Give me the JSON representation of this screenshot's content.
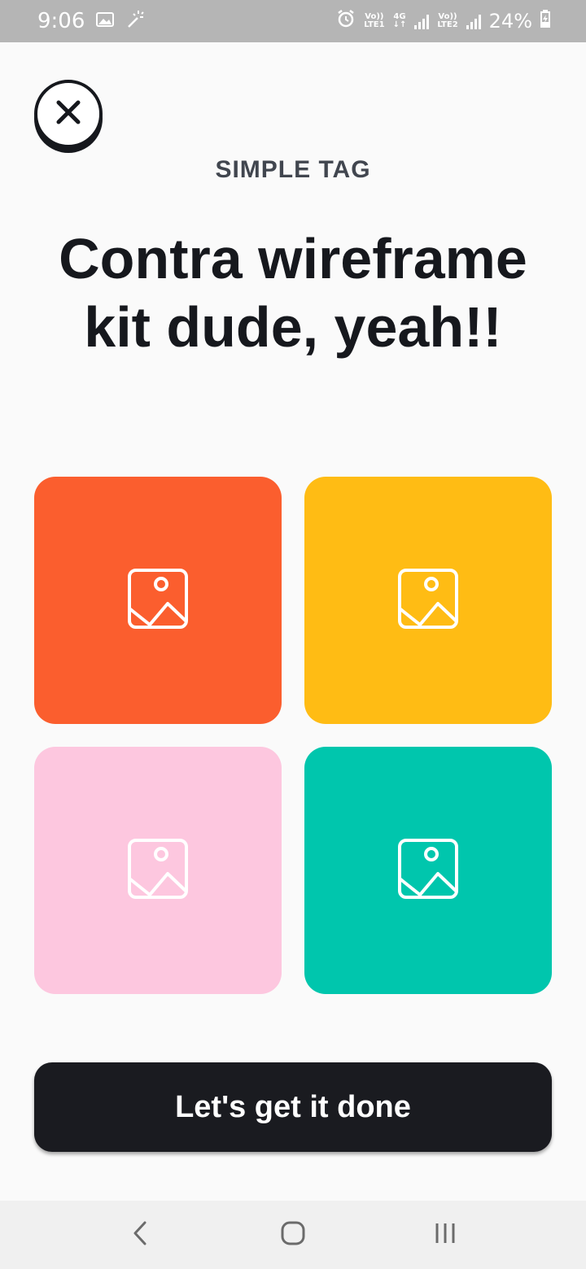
{
  "status_bar": {
    "time": "9:06",
    "battery": "24%",
    "sim1_top": "Vo))",
    "sim1_bottom": "LTE1",
    "network": "4G",
    "sim2_top": "Vo))",
    "sim2_bottom": "LTE2",
    "icons": [
      "image-icon",
      "magic-wand-icon",
      "alarm-icon",
      "signal-icon",
      "battery-charging-icon"
    ]
  },
  "header": {
    "kicker": "SIMPLE TAG",
    "title": "Contra wireframe kit dude, yeah!!"
  },
  "tiles": [
    {
      "color": "#fb5e2e",
      "icon": "image-placeholder-icon"
    },
    {
      "color": "#ffbc14",
      "icon": "image-placeholder-icon"
    },
    {
      "color": "#fdc7df",
      "icon": "image-placeholder-icon"
    },
    {
      "color": "#00c6ad",
      "icon": "image-placeholder-icon"
    }
  ],
  "cta": {
    "label": "Let's get it done"
  },
  "nav": {
    "icons": [
      "back-icon",
      "home-icon",
      "recents-icon"
    ]
  }
}
